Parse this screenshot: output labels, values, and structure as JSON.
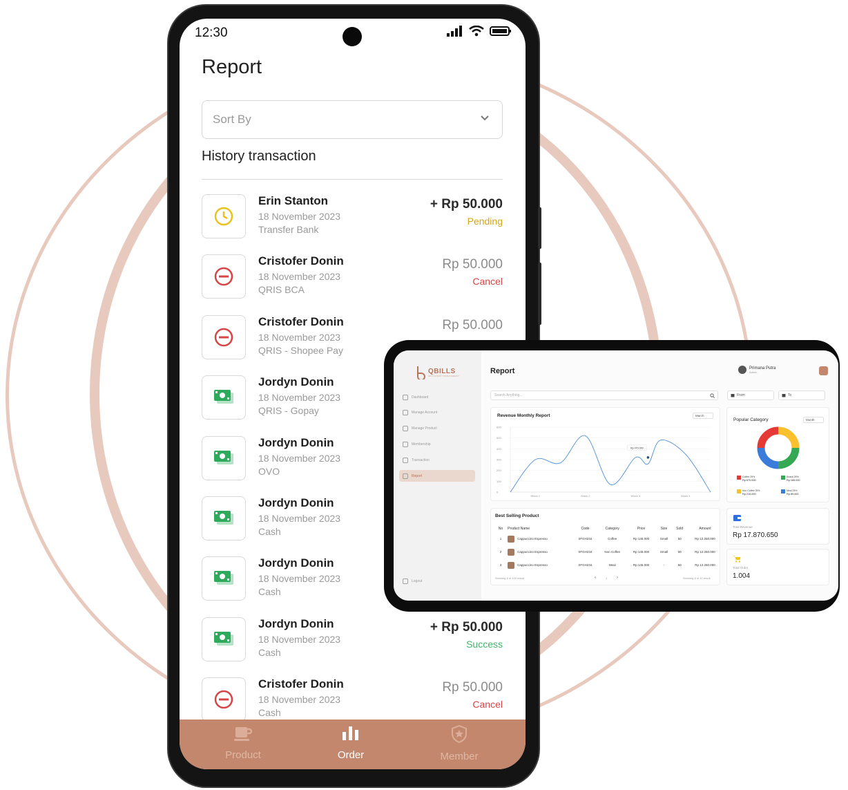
{
  "phone": {
    "status_time": "12:30",
    "title": "Report",
    "sort_placeholder": "Sort By",
    "history_title": "History transaction",
    "transactions": [
      {
        "name": "Erin Stanton",
        "date": "18 November 2023",
        "method": "Transfer Bank",
        "amount": "+ Rp 50.000",
        "status": "Pending",
        "icon": "clock-icon"
      },
      {
        "name": "Cristofer Donin",
        "date": "18 November 2023",
        "method": "QRIS BCA",
        "amount": "Rp 50.000",
        "status": "Cancel",
        "icon": "cancel-icon"
      },
      {
        "name": "Cristofer Donin",
        "date": "18 November 2023",
        "method": "QRIS - Shopee Pay",
        "amount": "Rp 50.000",
        "status": "",
        "icon": "cancel-icon"
      },
      {
        "name": "Jordyn Donin",
        "date": "18 November 2023",
        "method": "QRIS - Gopay",
        "amount": "",
        "status": "",
        "icon": "cash-icon"
      },
      {
        "name": "Jordyn Donin",
        "date": "18 November 2023",
        "method": "OVO",
        "amount": "",
        "status": "",
        "icon": "cash-icon"
      },
      {
        "name": "Jordyn Donin",
        "date": "18 November 2023",
        "method": "Cash",
        "amount": "",
        "status": "",
        "icon": "cash-icon"
      },
      {
        "name": "Jordyn Donin",
        "date": "18 November 2023",
        "method": "Cash",
        "amount": "",
        "status": "",
        "icon": "cash-icon"
      },
      {
        "name": "Jordyn Donin",
        "date": "18 November 2023",
        "method": "Cash",
        "amount": "+ Rp 50.000",
        "status": "Success",
        "icon": "cash-icon"
      },
      {
        "name": "Cristofer Donin",
        "date": "18 November 2023",
        "method": "Cash",
        "amount": "Rp 50.000",
        "status": "Cancel",
        "icon": "cancel-icon"
      }
    ],
    "nav": [
      {
        "label": "Product",
        "icon": "coffee-cup-icon"
      },
      {
        "label": "Order",
        "icon": "bar-chart-icon"
      },
      {
        "label": "Member",
        "icon": "shield-star-icon"
      }
    ],
    "colors": {
      "pending": "#d4a51a",
      "cancel": "#d64545",
      "success": "#43b36b",
      "nav_bg": "#c2876c"
    }
  },
  "tablet": {
    "brand": "QBILLS",
    "brand_tagline": "RESTAURANT MANAGEMENT",
    "menu": [
      {
        "label": "Dashboard",
        "active": false
      },
      {
        "label": "Manage Account",
        "active": false
      },
      {
        "label": "Manage Product",
        "active": false
      },
      {
        "label": "Membership",
        "active": false
      },
      {
        "label": "Transaction",
        "active": false
      },
      {
        "label": "Report",
        "active": true
      }
    ],
    "logout": "Logout",
    "title": "Report",
    "user_name": "Primana Putra",
    "user_role": "Admin",
    "search_placeholder": "Search Anything...",
    "from_label": "From",
    "to_label": "To",
    "revenue": {
      "title": "Revenue Monthly Report",
      "period": "March",
      "tooltip": "Rp 470.000"
    },
    "popular": {
      "title": "Popular Category",
      "period": "Month"
    },
    "best_selling": {
      "title": "Best Selling Product",
      "headers": [
        "No",
        "Product Name",
        "Code",
        "Category",
        "Price",
        "Size",
        "Sold",
        "Amount"
      ],
      "rows": [
        [
          "1",
          "Cappuccino Espresso",
          "XFGH234",
          "Coffee",
          "Rp 145.000",
          "Small",
          "50",
          "Rp 12.250.000"
        ],
        [
          "2",
          "Cappuccino Espresso",
          "XFGH234",
          "Non Coffee",
          "Rp 145.000",
          "Small",
          "50",
          "Rp 12.250.000"
        ],
        [
          "3",
          "Cappuccino Espresso",
          "XFGH234",
          "Meal",
          "Rp 145.000",
          "-",
          "50",
          "Rp 12.250.000"
        ]
      ],
      "footer_left": "Showing 4 of 100 result",
      "footer_right": "Showing 4 of 10 result",
      "page": "1"
    },
    "total_revenue": {
      "label": "Total Revenue",
      "value": "Rp 17.870.650"
    },
    "total_order": {
      "label": "Total Order",
      "value": "1.004"
    }
  },
  "chart_data": [
    {
      "type": "line",
      "title": "Revenue Monthly Report",
      "categories": [
        "Week 1",
        "Week 2",
        "Week 3",
        "Week 4"
      ],
      "y_ticks": [
        "600",
        "500",
        "400",
        "300",
        "200",
        "100",
        "0"
      ],
      "ylim": [
        0,
        600
      ],
      "x": [
        0,
        0.5,
        1,
        1.5,
        2,
        2.5,
        2.75,
        3,
        3.5,
        4
      ],
      "values": [
        0,
        300,
        270,
        520,
        70,
        320,
        260,
        480,
        350,
        0
      ],
      "color": "#4a90d9",
      "annotation": {
        "x": 2.75,
        "y": 320,
        "label": "Rp 470.000"
      }
    },
    {
      "type": "pie",
      "title": "Popular Category",
      "slices": [
        {
          "label": "Coffee 25%",
          "sublabel": "Rp 670.000",
          "value": 25,
          "color": "#e53935"
        },
        {
          "label": "Snack 25%",
          "sublabel": "Rp 165.000",
          "value": 25,
          "color": "#34a853"
        },
        {
          "label": "Non Coffee 25%",
          "sublabel": "Rp 210.000",
          "value": 25,
          "color": "#fbc02d"
        },
        {
          "label": "Meal 25%",
          "sublabel": "Rp 89.000",
          "value": 25,
          "color": "#3b7bd9"
        }
      ]
    }
  ]
}
